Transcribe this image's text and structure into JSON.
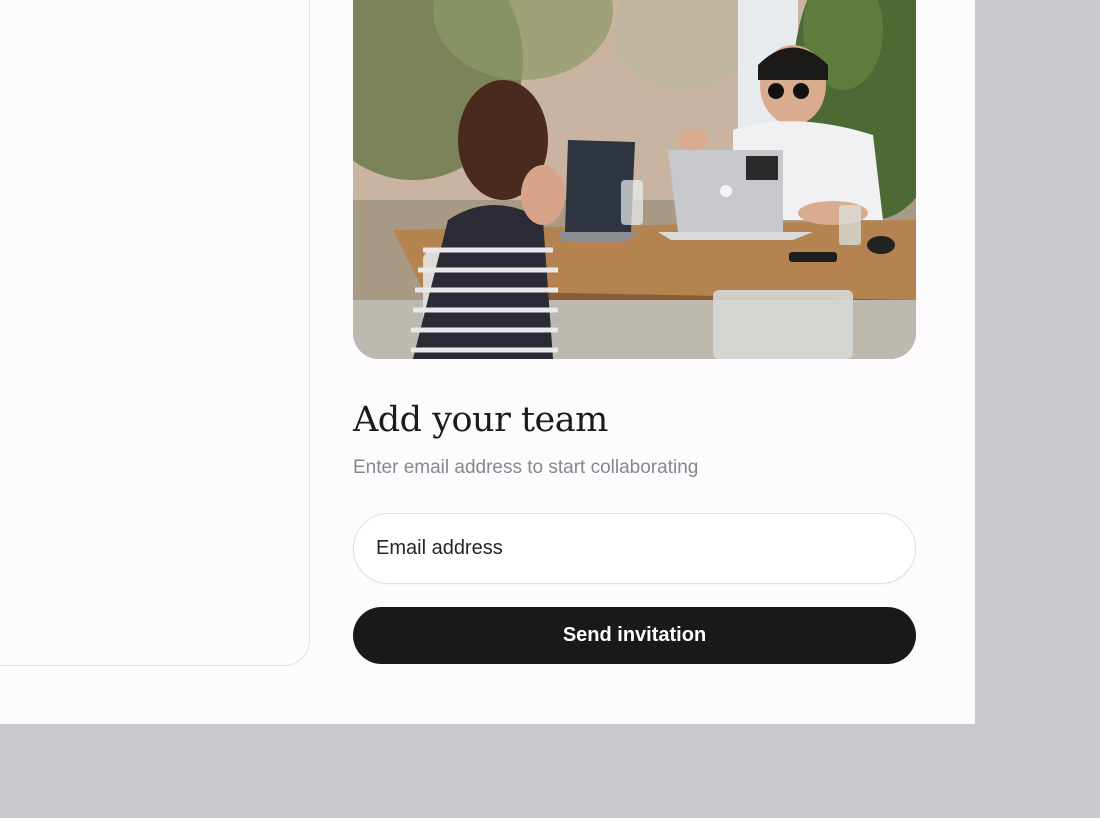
{
  "invite": {
    "title": "Add your team",
    "subtitle": "Enter email address to start collaborating",
    "email_placeholder": "Email address",
    "send_label": "Send invitation"
  },
  "photo": {
    "subject": "Two people working on laptops at an outdoor wooden table"
  },
  "colors": {
    "page_background": "#c9c8cc",
    "panel_background": "#fdfbfd",
    "button_background": "#1a181b",
    "button_text": "#ffffff",
    "subtitle_text": "#8a878c"
  }
}
